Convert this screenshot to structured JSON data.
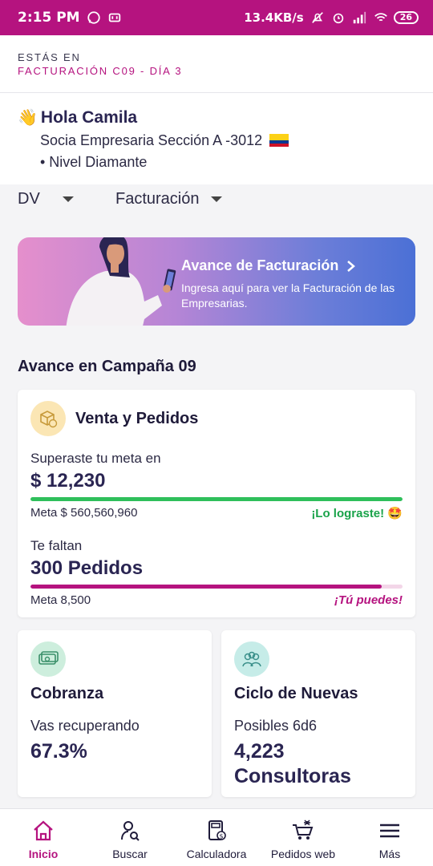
{
  "status_bar": {
    "time": "2:15 PM",
    "net_speed": "13.4KB/s",
    "battery": "26"
  },
  "context": {
    "line1": "ESTÁS EN",
    "line2": "FACTURACIÓN C09 - DÍA 3"
  },
  "greeting": {
    "hello": "Hola Camila",
    "role": "Socia Empresaria Sección A -3012",
    "level": "• Nivel Diamante"
  },
  "dropdowns": {
    "first": "DV",
    "second": "Facturación"
  },
  "banner": {
    "title": "Avance de Facturación",
    "description": "Ingresa aquí para ver la Facturación de las Empresarias."
  },
  "section_title": "Avance en Campaña 09",
  "sales": {
    "title": "Venta y Pedidos",
    "goal_label": "Superaste tu meta en",
    "goal_value": "$ 12,230",
    "goal_meta": "Meta $ 560,560,960",
    "goal_status": "¡Lo lograste! 🤩",
    "goal_progress": 1.0,
    "orders_label": "Te faltan",
    "orders_value": "300 Pedidos",
    "orders_meta": "Meta 8,500",
    "orders_status": "¡Tú puedes!",
    "orders_progress": 0.945
  },
  "cobranza": {
    "title": "Cobranza",
    "label": "Vas recuperando",
    "value": "67.3%"
  },
  "nuevas": {
    "title": "Ciclo de Nuevas",
    "label": "Posibles 6d6",
    "value_line1": "4,223",
    "value_line2": "Consultoras"
  },
  "nav": [
    {
      "label": "Inicio",
      "icon": "home-icon"
    },
    {
      "label": "Buscar",
      "icon": "search-person-icon"
    },
    {
      "label": "Calculadora",
      "icon": "calculator-icon"
    },
    {
      "label": "Pedidos web",
      "icon": "cart-icon"
    },
    {
      "label": "Más",
      "icon": "menu-icon"
    }
  ],
  "colors": {
    "brand": "#b5137f",
    "success": "#1aa34a",
    "dark": "#2a2552"
  }
}
